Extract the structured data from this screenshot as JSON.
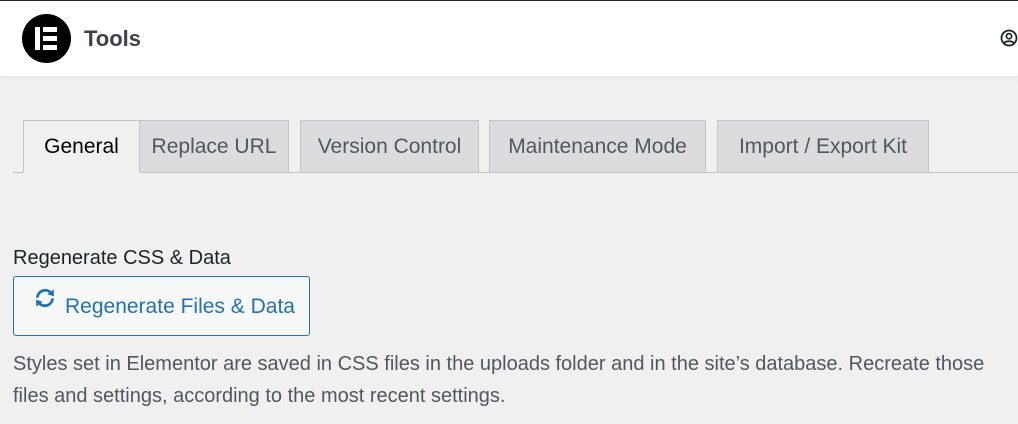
{
  "header": {
    "title": "Tools",
    "logo_icon": "elementor-logo",
    "profile_icon": "user-circle-icon"
  },
  "tabs": [
    {
      "label": "General",
      "active": true
    },
    {
      "label": "Replace URL",
      "active": false
    },
    {
      "label": "Version Control",
      "active": false
    },
    {
      "label": "Maintenance Mode",
      "active": false
    },
    {
      "label": "Import / Export Kit",
      "active": false
    }
  ],
  "regenerate": {
    "heading": "Regenerate CSS & Data",
    "button_label": "Regenerate Files & Data",
    "button_icon": "refresh-icon",
    "description_line1": "Styles set in Elementor are saved in CSS files in the uploads folder and in the site’s database. Recreate those",
    "description_line2": "files and settings, according to the most recent settings."
  },
  "colors": {
    "accent": "#2271b1",
    "page_background": "#f0f0f1",
    "header_background": "#ffffff",
    "tab_inactive": "#dcdcde"
  }
}
